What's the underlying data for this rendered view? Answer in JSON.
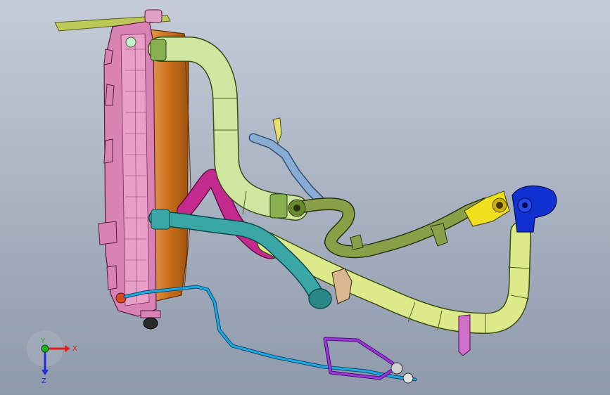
{
  "viewport": {
    "background_top": "#c4ccd8",
    "background_bottom": "#8e99ab"
  },
  "triad": {
    "x_label": "X",
    "y_label": "Y",
    "z_label": "Z",
    "x_color": "#e02020",
    "y_color": "#20b020",
    "z_color": "#2030d0"
  },
  "colors": {
    "radiator": "#d982b4",
    "fan_shroud": "#c8701e",
    "upper_hose": "#cfe6a0",
    "lower_hose": "#dcea8c",
    "magenta_hose": "#c42a8e",
    "teal_hose": "#3aa7a6",
    "steel_pipe": "#78a0c8",
    "olive_pipe": "#8aa048",
    "yellow_fitting": "#f0e020",
    "blue_fitting": "#1030d0",
    "cyan_line": "#20a8e0",
    "purple_bracket": "#9a38d8",
    "top_bar": "#b8c850"
  }
}
